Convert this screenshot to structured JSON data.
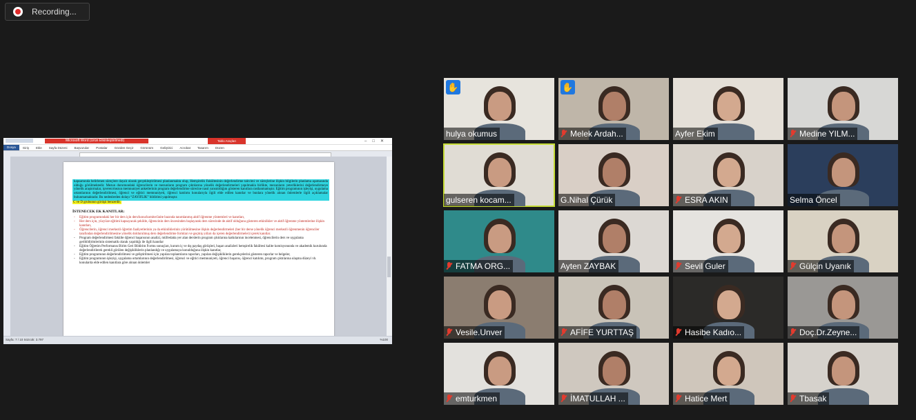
{
  "recording": {
    "label": "Recording..."
  },
  "shared_screen": {
    "window_title": "Microsoft Word (Ürün Etkinleştirilmedi)",
    "context_tab": "Tablo Araçları",
    "menu": [
      "Dosya",
      "Giriş",
      "Ekle",
      "Sayfa Düzeni",
      "Başvurular",
      "Postalar",
      "Gözden Geçir",
      "Görünüm",
      "Geliştirici",
      "Acrobat",
      "Tasarım",
      "Düzen"
    ],
    "highlight_para": "kapsamında belirlenen süreçlere dayalı olarak gerçekleştirilmesi planlanmakta olup, Hemşirelik Fakültesinin değerlendirme takvimi ve süreçlerine ilişkin bilgilerin planlama aşamasında olduğu görülmektedir. Mezun durumundaki öğrencilerin ve mezunların program çıktılarına yönelik değerlendirmeleri yapılmakla birlikte, mezunların yeterliklerini değerlendirmeye yönelik araştırmalar, işveren/mezun memnuniyet anketlerinin program değerlendirme sürecine nasıl yansıtıldığını gösteren kanıtlara rastlanmamıştır. Eğitim programının işleyişi, uygulama ortamlarının değerlendirilmesi, öğrenci ve eğitici memnuniyeti, öğrenci katılımı konularıyla ilgili elde edilen kanıtlar ve bunlara yönelik alınan önlemlerle ilgili açıklamalar bulunmamaktadır. Bu nedenlerden dolayı “ZAYIFLIK” bildirimi yapılmıştır.",
    "yellow_line": "C ve D grubunun görüşü benzerdir.",
    "section_heading": "İSTENECEK EK KANITLAR:",
    "red_items": [
      "Eğitim programındaki her bir ders için ders/konu/komite/ünite bazında tanımlanmış aktif öğrenme yöntemleri ve kanıtları,",
      "Her ders için, yüzyüze eğitimi kapsayacak şekilde, öğrencinin ders öncesinden başlayarak ders sürecinde de aktif olduğunu gösteren etkinlikler ve aktif öğrenme yöntemlerine ilişkin kanıtları,",
      "Öğrencilerin, öğrenci merkezli öğretim faaliyetlerinin ya da etkinliklerinin yürütülmesine ilişkin değerlendirmeleri (her bir derse yönelik öğrenci merkezli öğrenmenin öğrenciler tarafından değerlendirilmesine yönelik doldurulmuş ders değerlendirme formları ve geçmiş yılları da içeren değerlendirmeler) içerek kanıtlar."
    ],
    "black_items": [
      "Program değerlendirmesi fakülte öğrenci başarısının analizi, müfredatta yer alan derslerin program çıktılarına katkılarının incelenmesi, öğrencilerin ders ve uygulama geribildirimlerinin sistematik olarak yapıldığı ile ilgili kanıtlar",
      "Eğitim Öğretim Performansı Birim Geri Bildirim Formu sonuçları, kurum iç ve dış paydaş görüşleri, başarı analizleri hemşirelik fakültesi kalite komisyonunda ve akademik kurulunda değerlendirilerek gerekli görülen değişikliklerin planlandığı ve uygulamaya konulduğuna ilişkin kanıtlar,",
      "Eğitim programının değerlendirilmesi ve geliştirilmesi için yapılan toplantıların raporları, yapılan değişikliklerin gerekçelerini gösteren raporlar ve belgeler,",
      "Eğitim programının işleyişi, uygulama ortamlarının değerlendirilmesi, öğrenci ve eğitici memnuniyeti, öğrenci başarısı, öğrenci katılımı, program çıktılarına ulaşma düzeyi vb. konularda elde edilen kanıtlara göre alınan önlemler"
    ],
    "status_left": "Sayfa: 7 / 10   Sözcük: 3.797",
    "zoom": "%100"
  },
  "participants": [
    {
      "name": "hulya okumus",
      "muted": false,
      "hand": true,
      "bg": "#e7e4dd"
    },
    {
      "name": "Melek Ardah...",
      "muted": true,
      "hand": true,
      "bg": "#bfb6a9"
    },
    {
      "name": "Ayfer Ekim",
      "muted": false,
      "hand": false,
      "bg": "#e4dfd7"
    },
    {
      "name": "Medine YILM...",
      "muted": true,
      "hand": false,
      "bg": "#d7d7d5"
    },
    {
      "name": "gulseren kocam...",
      "muted": false,
      "hand": false,
      "bg": "#e0dcd4",
      "active": true
    },
    {
      "name": "G.Nihal Çürük",
      "muted": false,
      "hand": false,
      "bg": "#d9cfc6"
    },
    {
      "name": "ESRA AKIN",
      "muted": true,
      "hand": false,
      "bg": "#d8d2ca"
    },
    {
      "name": "Selma Öncel",
      "muted": false,
      "hand": false,
      "bg": "#2b3e5c"
    },
    {
      "name": "FATMA ORG...",
      "muted": true,
      "hand": false,
      "bg": "#2f8a8a"
    },
    {
      "name": "Ayten ZAYBAK",
      "muted": false,
      "hand": false,
      "bg": "#dcd8d3"
    },
    {
      "name": "Sevil Guler",
      "muted": true,
      "hand": false,
      "bg": "#e5e3df"
    },
    {
      "name": "Gülçin Uyanık",
      "muted": true,
      "hand": false,
      "bg": "#d9d2c3"
    },
    {
      "name": "Vesile.Unver",
      "muted": true,
      "hand": false,
      "bg": "#8b7d70"
    },
    {
      "name": "AFİFE YURTTAŞ",
      "muted": true,
      "hand": false,
      "bg": "#c9c3b8"
    },
    {
      "name": "Hasibe Kadıo...",
      "muted": true,
      "hand": false,
      "bg": "#2b2a28"
    },
    {
      "name": "Doç.Dr.Zeyne...",
      "muted": true,
      "hand": false,
      "bg": "#9a9895"
    },
    {
      "name": "emturkmen",
      "muted": true,
      "hand": false,
      "bg": "#e3e1dd"
    },
    {
      "name": "İMATULLAH ...",
      "muted": true,
      "hand": false,
      "bg": "#cfc8bf"
    },
    {
      "name": "Hatice Mert",
      "muted": true,
      "hand": false,
      "bg": "#cfc6bb"
    },
    {
      "name": "Tbasak",
      "muted": true,
      "hand": false,
      "bg": "#d6d2cc"
    }
  ]
}
